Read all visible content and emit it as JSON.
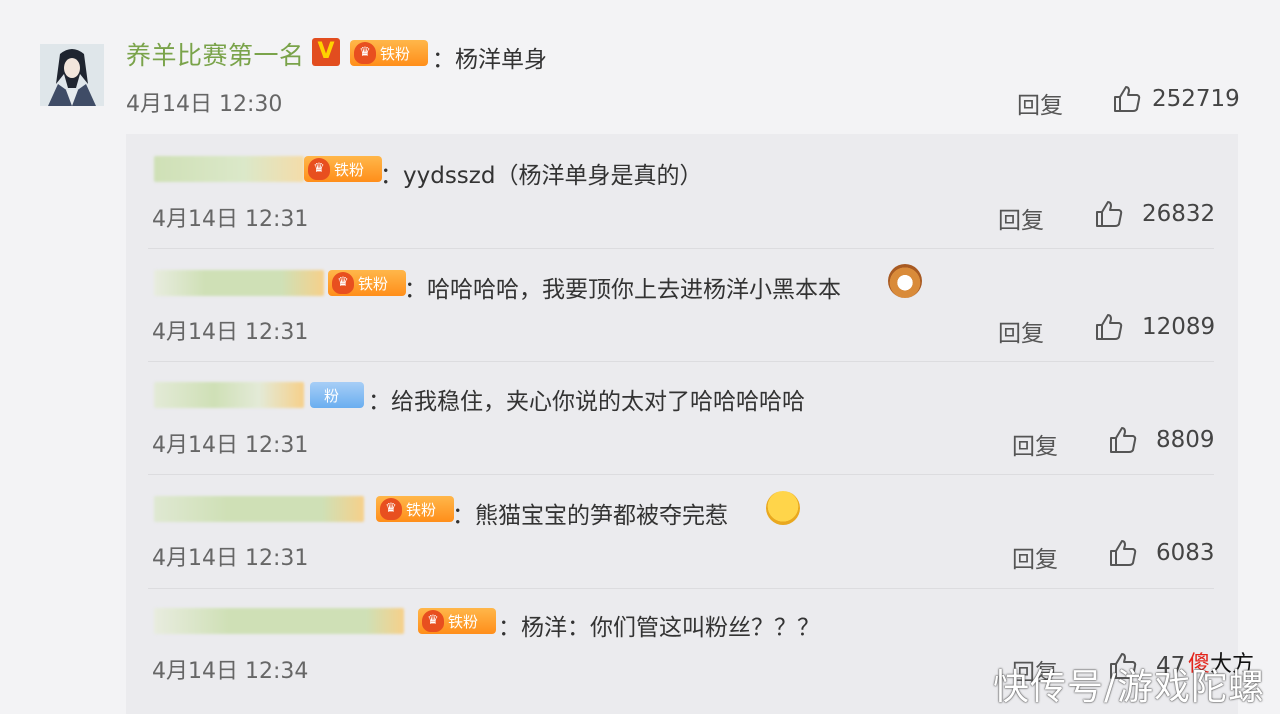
{
  "main_comment": {
    "username": "养羊比赛第一名",
    "verified_label": "V",
    "fan_badge": "铁粉",
    "text": "：杨洋单身",
    "time": "4月14日 12:30",
    "reply_label": "回复",
    "likes": "252719"
  },
  "replies": [
    {
      "fan_badge": "铁粉",
      "text": "：yydsszd（杨洋单身是真的）",
      "time": "4月14日 12:31",
      "reply_label": "回复",
      "likes": "26832"
    },
    {
      "fan_badge": "铁粉",
      "text": "：哈哈哈哈，我要顶你上去进杨洋小黑本本",
      "time": "4月14日 12:31",
      "reply_label": "回复",
      "likes": "12089"
    },
    {
      "fan_badge": "粉",
      "text": "：给我稳住，夹心你说的太对了哈哈哈哈哈",
      "time": "4月14日 12:31",
      "reply_label": "回复",
      "likes": "8809"
    },
    {
      "fan_badge": "铁粉",
      "text": "：熊猫宝宝的笋都被夺完惹",
      "time": "4月14日 12:31",
      "reply_label": "回复",
      "likes": "6083"
    },
    {
      "fan_badge": "铁粉",
      "text": "：杨洋：你们管这叫粉丝？？？",
      "time": "4月14日 12:34",
      "reply_label": "回复",
      "likes": "47"
    }
  ],
  "watermark": {
    "line1_red": "傻",
    "line1_rest": "大方",
    "line2": "快传号/游戏陀螺"
  },
  "colors": {
    "username": "#7aa34a",
    "badge_orange": "#ff8e1a",
    "verified": "#e24d1f"
  }
}
